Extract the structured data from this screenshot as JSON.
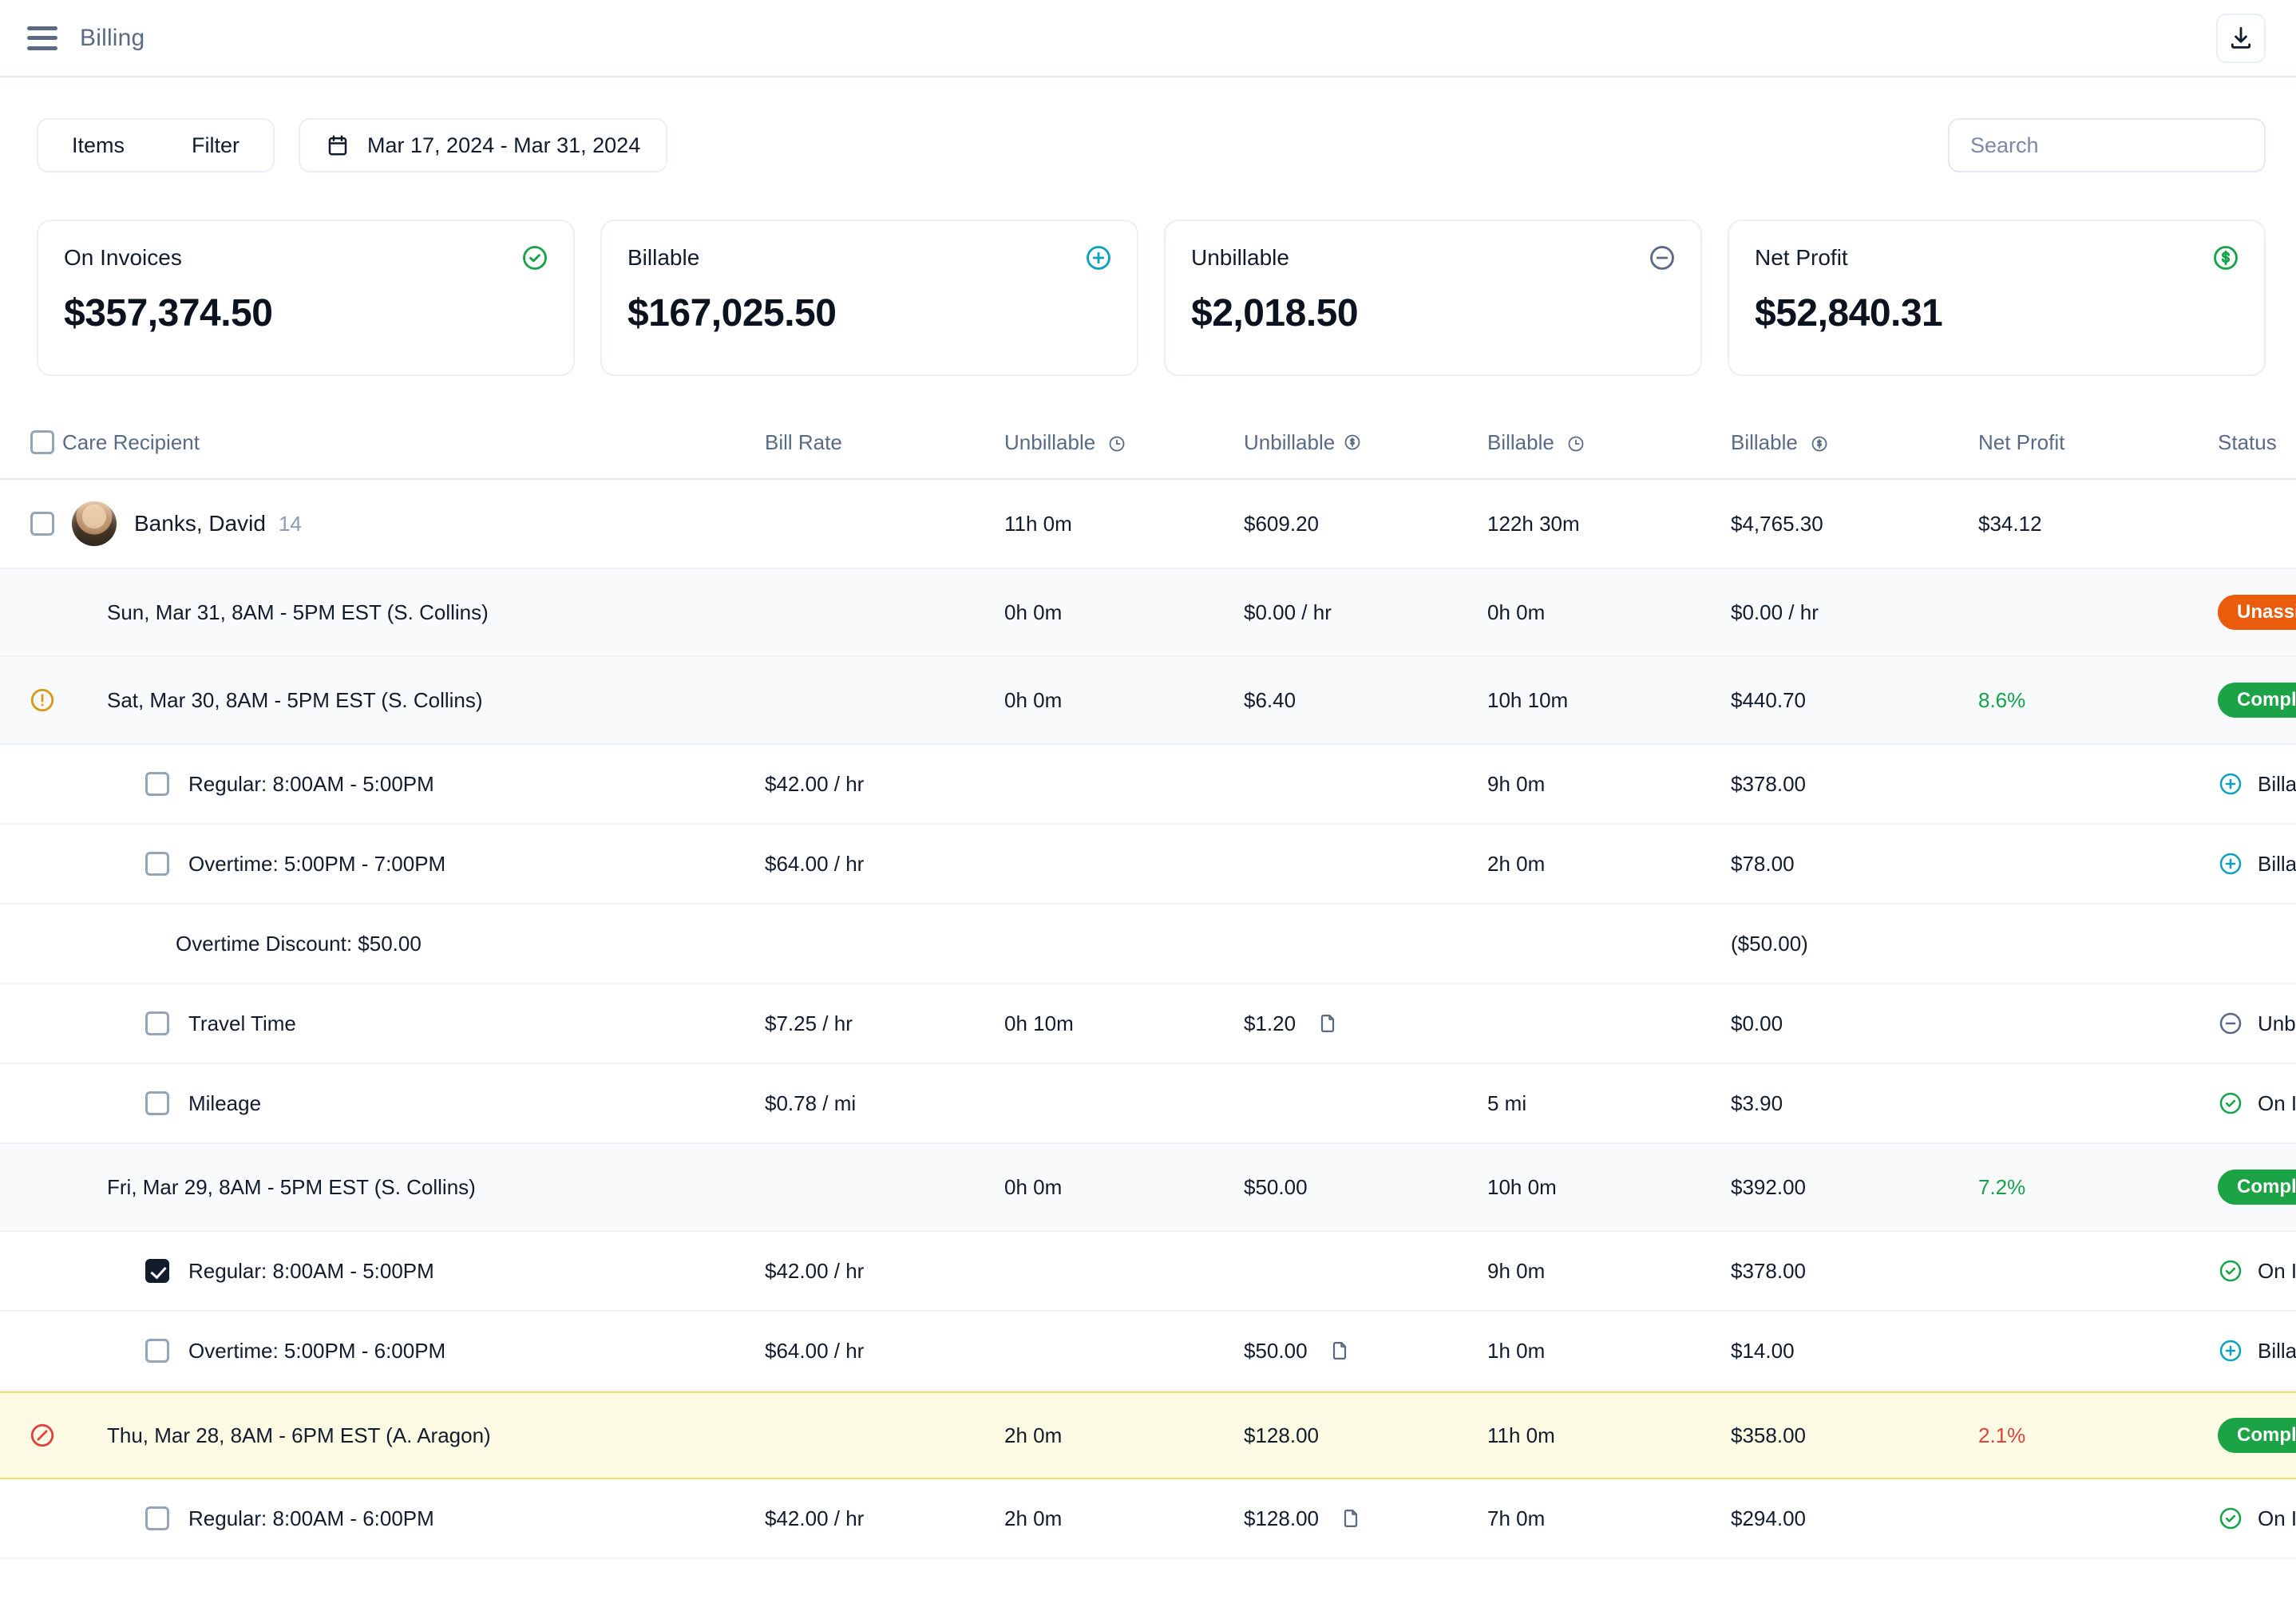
{
  "topbar": {
    "title": "Billing",
    "menu_icon": "hamburger-menu-icon",
    "download_icon": "download-icon"
  },
  "controls": {
    "tabs": [
      {
        "label": "Items"
      },
      {
        "label": "Filter"
      }
    ],
    "date_range": {
      "icon": "calendar-icon",
      "label": "Mar 17, 2024 - Mar 31, 2024"
    },
    "search": {
      "placeholder": "Search",
      "value": ""
    }
  },
  "cards": [
    {
      "label": "On Invoices",
      "value": "$357,374.50",
      "icon": "check-circle-icon",
      "color": "#16a34a"
    },
    {
      "label": "Billable",
      "value": "$167,025.50",
      "icon": "plus-circle-icon",
      "color": "#0aa2c0"
    },
    {
      "label": "Unbillable",
      "value": "$2,018.50",
      "icon": "minus-circle-icon",
      "color": "#5a6a85"
    },
    {
      "label": "Net Profit",
      "value": "$52,840.31",
      "icon": "dollar-circle-icon",
      "color": "#16a34a"
    }
  ],
  "table": {
    "columns": [
      {
        "label": "Care Recipient",
        "icon": ""
      },
      {
        "label": "Bill Rate",
        "icon": ""
      },
      {
        "label": "Unbillable",
        "icon": "clock-icon"
      },
      {
        "label": "Unbillable",
        "icon": "dollar-icon"
      },
      {
        "label": "Billable",
        "icon": "clock-icon"
      },
      {
        "label": "Billable",
        "icon": "dollar-icon"
      },
      {
        "label": "Net Profit",
        "icon": ""
      },
      {
        "label": "Status",
        "icon": ""
      }
    ],
    "collapse_icon": "chevron-down-icon",
    "rows": [
      {
        "type": "parent",
        "checkbox": "unchecked",
        "avatar": "avatar",
        "name": "Banks, David",
        "count": "14",
        "bill_rate": "",
        "unbillable_hours": "11h 0m",
        "unbillable_amount": "$609.20",
        "billable_hours": "122h 30m",
        "billable_amount": "$4,765.30",
        "net_profit": "$34.12",
        "status": "",
        "expand_icon": "chevron-up-icon"
      },
      {
        "type": "shift",
        "flag_icon": "",
        "name": "Sun, Mar 31, 8AM - 5PM EST (S. Collins)",
        "bill_rate": "",
        "unbillable_hours": "0h 0m",
        "unbillable_amount": "$0.00 / hr",
        "billable_hours": "0h 0m",
        "billable_amount": "$0.00 / hr",
        "net_profit": "",
        "status_badge": "Unassigned",
        "status_kind": "unassigned"
      },
      {
        "type": "shift",
        "flag_icon": "warning-circle-icon",
        "name": "Sat, Mar 30, 8AM - 5PM EST (S. Collins)",
        "bill_rate": "",
        "unbillable_hours": "0h 0m",
        "unbillable_amount": "$6.40",
        "billable_hours": "10h 10m",
        "billable_amount": "$440.70",
        "net_profit": "8.6%",
        "net_profit_kind": "green",
        "status_badge": "Completed",
        "status_kind": "completed"
      },
      {
        "type": "detail",
        "checkbox": "unchecked",
        "name": "Regular: 8:00AM - 5:00PM",
        "bill_rate": "$42.00 / hr",
        "unbillable_hours": "",
        "unbillable_amount": "",
        "doc_icon": "",
        "billable_hours": "9h 0m",
        "billable_amount": "$378.00",
        "net_profit": "",
        "status_icon": "plus-circle-icon",
        "status_text": "Billable",
        "status_color": "#0aa2c0",
        "menu_icon": "more-vertical-icon"
      },
      {
        "type": "detail",
        "checkbox": "unchecked",
        "name": "Overtime: 5:00PM - 7:00PM",
        "bill_rate": "$64.00 / hr",
        "unbillable_hours": "",
        "unbillable_amount": "",
        "doc_icon": "",
        "billable_hours": "2h 0m",
        "billable_amount": "$78.00",
        "net_profit": "",
        "status_icon": "plus-circle-icon",
        "status_text": "Billable",
        "status_color": "#0aa2c0",
        "menu_icon": "more-vertical-icon"
      },
      {
        "type": "note",
        "name": "Overtime Discount: $50.00",
        "bill_rate": "",
        "unbillable_hours": "",
        "unbillable_amount": "",
        "doc_icon": "",
        "billable_hours": "",
        "billable_amount": "($50.00)",
        "net_profit": "",
        "status_icon": "",
        "status_text": "",
        "menu_icon": "more-vertical-icon"
      },
      {
        "type": "detail",
        "checkbox": "unchecked",
        "name": "Travel Time",
        "bill_rate": "$7.25 / hr",
        "unbillable_hours": "0h 10m",
        "unbillable_amount": "$1.20",
        "doc_icon": "document-icon",
        "billable_hours": "",
        "billable_amount": "$0.00",
        "net_profit": "",
        "status_icon": "minus-circle-icon",
        "status_text": "Unbillable",
        "status_color": "#5a6a85",
        "menu_icon": "more-vertical-icon"
      },
      {
        "type": "detail",
        "checkbox": "unchecked",
        "name": "Mileage",
        "bill_rate": "$0.78 / mi",
        "unbillable_hours": "",
        "unbillable_amount": "",
        "doc_icon": "",
        "billable_hours": "5 mi",
        "billable_amount": "$3.90",
        "net_profit": "",
        "status_icon": "check-circle-icon",
        "status_text": "On Invoice",
        "status_color": "#16a34a",
        "menu_icon": "more-vertical-icon"
      },
      {
        "type": "shift",
        "flag_icon": "",
        "name": "Fri, Mar 29, 8AM - 5PM EST (S. Collins)",
        "bill_rate": "",
        "unbillable_hours": "0h 0m",
        "unbillable_amount": "$50.00",
        "billable_hours": "10h 0m",
        "billable_amount": "$392.00",
        "net_profit": "7.2%",
        "net_profit_kind": "green",
        "status_badge": "Completed",
        "status_kind": "completed"
      },
      {
        "type": "detail",
        "checkbox": "checked",
        "name": "Regular: 8:00AM - 5:00PM",
        "bill_rate": "$42.00 / hr",
        "unbillable_hours": "",
        "unbillable_amount": "",
        "doc_icon": "",
        "billable_hours": "9h 0m",
        "billable_amount": "$378.00",
        "net_profit": "",
        "status_icon": "check-circle-icon",
        "status_text": "On Invoice",
        "status_color": "#16a34a",
        "menu_icon": "more-vertical-icon"
      },
      {
        "type": "detail",
        "checkbox": "unchecked",
        "name": "Overtime: 5:00PM - 6:00PM",
        "bill_rate": "$64.00 / hr",
        "unbillable_hours": "",
        "unbillable_amount": "$50.00",
        "doc_icon": "document-icon",
        "billable_hours": "1h 0m",
        "billable_amount": "$14.00",
        "net_profit": "",
        "status_icon": "plus-circle-icon",
        "status_text": "Billable",
        "status_color": "#0aa2c0",
        "menu_icon": "more-vertical-icon"
      },
      {
        "type": "shift",
        "flagged": true,
        "flag_icon": "blocked-circle-icon",
        "name": "Thu, Mar 28, 8AM - 6PM EST (A. Aragon)",
        "bill_rate": "",
        "unbillable_hours": "2h 0m",
        "unbillable_amount": "$128.00",
        "billable_hours": "11h 0m",
        "billable_amount": "$358.00",
        "net_profit": "2.1%",
        "net_profit_kind": "red",
        "status_badge": "Completed",
        "status_kind": "completed"
      },
      {
        "type": "detail",
        "checkbox": "unchecked",
        "name": "Regular: 8:00AM - 6:00PM",
        "bill_rate": "$42.00 / hr",
        "unbillable_hours": "2h 0m",
        "unbillable_amount": "$128.00",
        "doc_icon": "document-icon",
        "billable_hours": "7h 0m",
        "billable_amount": "$294.00",
        "net_profit": "",
        "status_icon": "check-circle-icon",
        "status_text": "On Invoice",
        "status_color": "#16a34a",
        "menu_icon": "more-vertical-icon"
      }
    ]
  }
}
